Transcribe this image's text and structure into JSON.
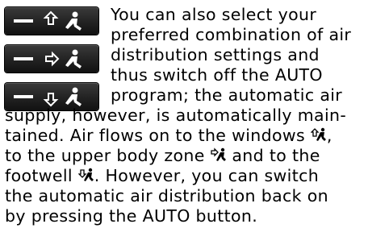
{
  "icons": {
    "button_1": "air-to-windows-button-icon",
    "button_2": "air-to-upper-body-button-icon",
    "button_3": "air-to-footwell-button-icon",
    "inline_windows": "air-to-windows-icon",
    "inline_upper_body": "air-to-upper-body-icon",
    "inline_footwell": "air-to-footwell-icon"
  },
  "text": {
    "line1": "You can also select your",
    "line2": "preferred combination of air",
    "line3": "distribution settings and",
    "line4": "thus switch off the AUTO",
    "line5": "program; the automatic air",
    "line6": "supply, however, is automatically main-",
    "line7": "tained. Air flows on to the windows ",
    "line7_end": ",",
    "line8_a": "to the upper body zone ",
    "line8_b": " and to the",
    "line9_a": "footwell ",
    "line9_b": ". However, you can switch",
    "line10": "the automatic air distribution back on",
    "line11": "by pressing the AUTO button."
  }
}
